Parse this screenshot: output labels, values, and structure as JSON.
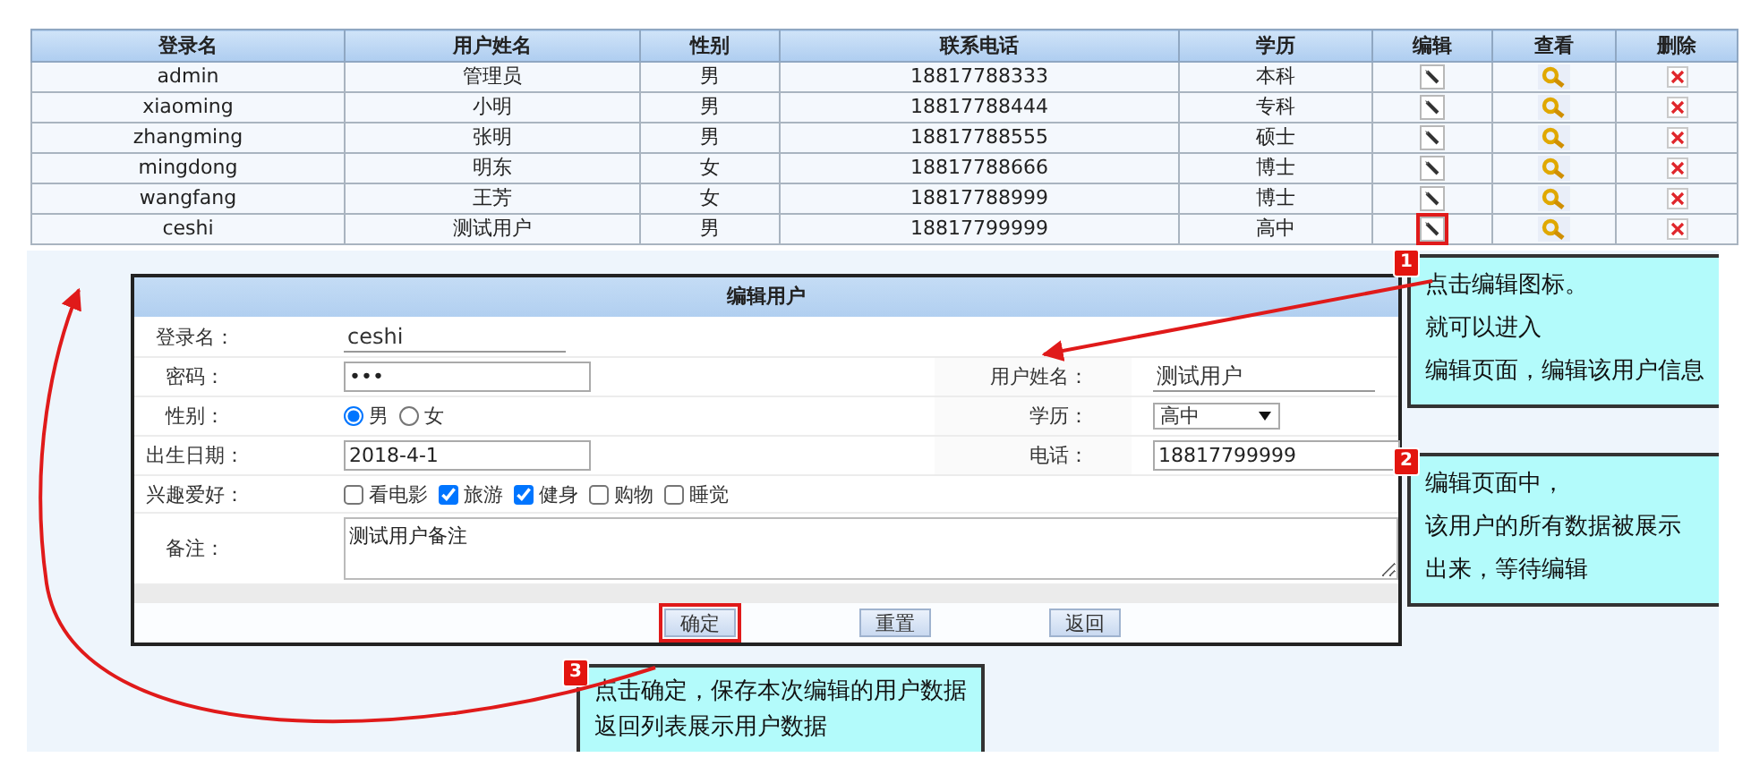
{
  "table": {
    "columns": [
      "登录名",
      "用户姓名",
      "性别",
      "联系电话",
      "学历",
      "编辑",
      "查看",
      "删除"
    ],
    "rows": [
      {
        "login": "admin",
        "name": "管理员",
        "gender": "男",
        "phone": "18817788333",
        "education": "本科",
        "highlighted": false
      },
      {
        "login": "xiaoming",
        "name": "小明",
        "gender": "男",
        "phone": "18817788444",
        "education": "专科",
        "highlighted": false
      },
      {
        "login": "zhangming",
        "name": "张明",
        "gender": "男",
        "phone": "18817788555",
        "education": "硕士",
        "highlighted": false
      },
      {
        "login": "mingdong",
        "name": "明东",
        "gender": "女",
        "phone": "18817788666",
        "education": "博士",
        "highlighted": false
      },
      {
        "login": "wangfang",
        "name": "王芳",
        "gender": "女",
        "phone": "18817788999",
        "education": "博士",
        "highlighted": false
      },
      {
        "login": "ceshi",
        "name": "测试用户",
        "gender": "男",
        "phone": "18817799999",
        "education": "高中",
        "highlighted": true
      }
    ]
  },
  "dialog": {
    "title": "编辑用户",
    "login": {
      "label": "登录名：",
      "value": "ceshi"
    },
    "password": {
      "label": "密码：",
      "value": "•••"
    },
    "full_name": {
      "label": "用户姓名：",
      "value": "测试用户"
    },
    "gender": {
      "label": "性别：",
      "options": [
        {
          "label": "男",
          "selected": true
        },
        {
          "label": "女",
          "selected": false
        }
      ]
    },
    "education": {
      "label": "学历：",
      "value": "高中"
    },
    "birth_date": {
      "label": "出生日期：",
      "value": "2018-4-1"
    },
    "phone": {
      "label": "电话：",
      "value": "18817799999"
    },
    "hobbies": {
      "label": "兴趣爱好：",
      "options": [
        {
          "label": "看电影",
          "checked": false
        },
        {
          "label": "旅游",
          "checked": true
        },
        {
          "label": "健身",
          "checked": true
        },
        {
          "label": "购物",
          "checked": false
        },
        {
          "label": "睡觉",
          "checked": false
        }
      ]
    },
    "remarks": {
      "label": "备注：",
      "value": "测试用户备注"
    },
    "buttons": [
      {
        "label": "确定",
        "highlighted": true
      },
      {
        "label": "重置",
        "highlighted": false
      },
      {
        "label": "返回",
        "highlighted": false
      }
    ]
  },
  "callouts": [
    {
      "badge": "1",
      "lines": [
        "点击编辑图标。",
        "就可以进入",
        "编辑页面，编辑该用户信息"
      ]
    },
    {
      "badge": "2",
      "lines": [
        "编辑页面中，",
        "该用户的所有数据被展示",
        "出来，等待编辑"
      ]
    },
    {
      "badge": "3",
      "lines": [
        "点击确定，保存本次编辑的用户数据",
        "返回列表展示用户数据"
      ]
    }
  ]
}
